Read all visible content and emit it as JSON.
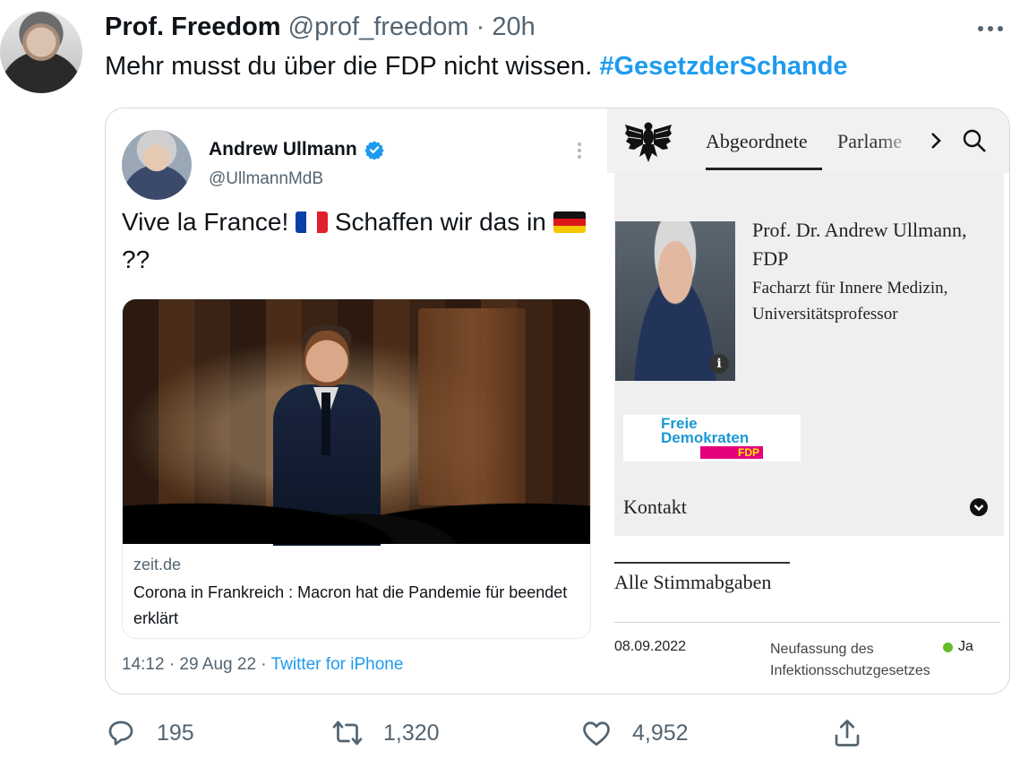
{
  "tweet": {
    "author_name": "Prof. Freedom",
    "author_handle": "@prof_freedom",
    "separator": "·",
    "time": "20h",
    "text": "Mehr musst du über die FDP nicht wissen.",
    "hashtag": "#GesetzderSchande"
  },
  "embedded_tweet": {
    "name": "Andrew Ullmann",
    "handle": "@UllmannMdB",
    "text_part1": "Vive la France!",
    "text_part2": "Schaffen wir das in",
    "text_part3": "??",
    "flags": [
      "flag-france-icon",
      "flag-germany-icon"
    ],
    "link": {
      "domain": "zeit.de",
      "title": "Corona in Frankreich : Macron hat die Pandemie für beendet erklärt"
    },
    "footer_time": "14:12 · 29 Aug 22 ·",
    "footer_source": "Twitter for iPhone"
  },
  "bundestag": {
    "nav_active": "Abgeordnete",
    "nav_next": "Parlame",
    "profile_name": "Prof. Dr. Andrew Ullmann, FDP",
    "profile_job": "Facharzt für Innere Medizin, Universitätsprofessor",
    "info_glyph": "i",
    "logo_line1": "Freie",
    "logo_line2": "Demokraten",
    "logo_bar": "FDP",
    "kontakt": "Kontakt",
    "votes_title": "Alle Stimmabgaben",
    "vote": {
      "date": "08.09.2022",
      "topic": "Neufassung des Infektionsschutzgesetzes",
      "result": "Ja",
      "result_color": "#66bb2a"
    }
  },
  "actions": {
    "replies": "195",
    "retweets": "1,320",
    "likes": "4,952"
  },
  "colors": {
    "link_blue": "#1d9bf0",
    "muted_text": "#536471",
    "border": "#cfd9de",
    "fdp_blue": "#1a98d5",
    "fdp_magenta": "#e5007d",
    "fdp_yellow": "#ffed00"
  }
}
